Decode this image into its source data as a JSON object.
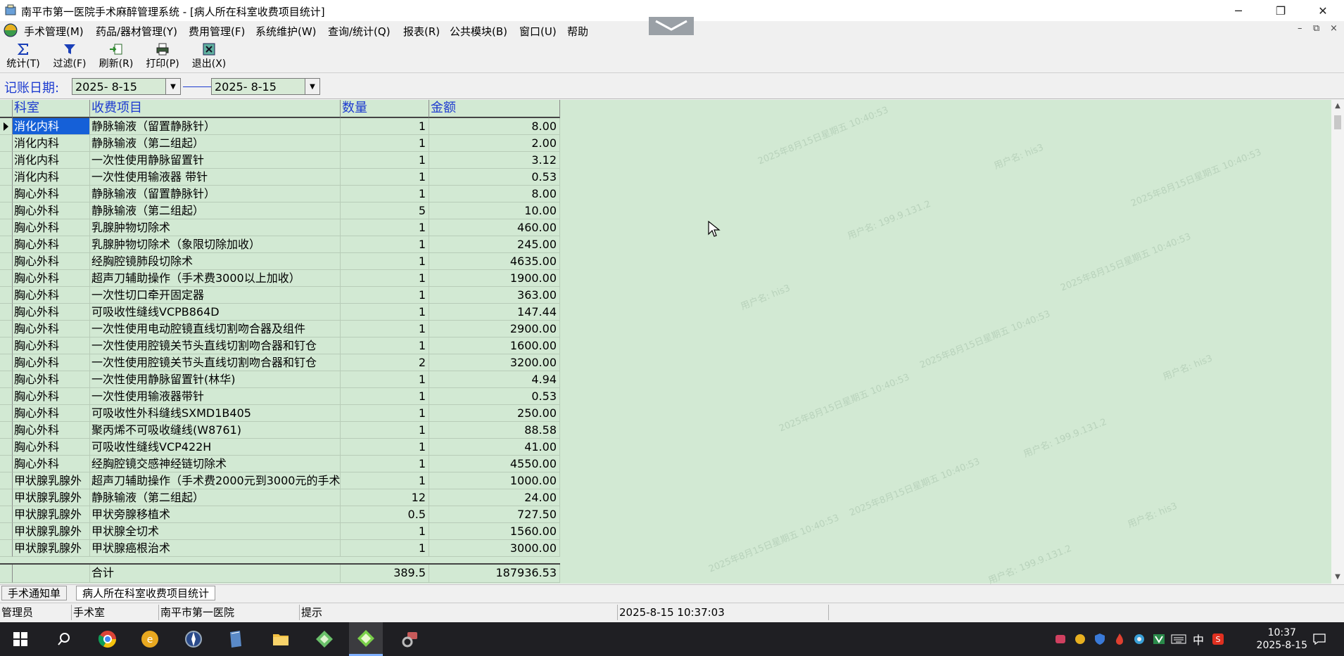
{
  "window": {
    "title": "南平市第一医院手术麻醉管理系统 - [病人所在科室收费项目统计]",
    "minimize": "─",
    "restore": "❐",
    "close": "✕"
  },
  "menu": [
    {
      "label": "手术管理(M)"
    },
    {
      "label": "药品/器材管理(Y)"
    },
    {
      "label": "费用管理(F)"
    },
    {
      "label": "系统维护(W)"
    },
    {
      "label": "查询/统计(Q)"
    },
    {
      "label": "报表(R)"
    },
    {
      "label": "公共模块(B)"
    },
    {
      "label": "窗口(U)"
    },
    {
      "label": "帮助"
    }
  ],
  "mdi_controls": {
    "minimize": "–",
    "restore": "⧉",
    "close": "×"
  },
  "toolbar": [
    {
      "label": "统计(T)",
      "icon": "sigma-icon"
    },
    {
      "label": "过滤(F)",
      "icon": "filter-icon"
    },
    {
      "label": "刷新(R)",
      "icon": "refresh-icon"
    },
    {
      "label": "打印(P)",
      "icon": "print-icon"
    },
    {
      "label": "退出(X)",
      "icon": "exit-icon"
    }
  ],
  "date_filter": {
    "label": "记账日期:",
    "start": "2025- 8-15",
    "end": "2025- 8-15"
  },
  "table": {
    "columns": [
      "科室",
      "收费项目",
      "数量",
      "金额"
    ],
    "rows": [
      {
        "dept": "消化内科",
        "item": "静脉输液（留置静脉针）",
        "qty": "1",
        "amount": "8.00"
      },
      {
        "dept": "消化内科",
        "item": "静脉输液（第二组起）",
        "qty": "1",
        "amount": "2.00"
      },
      {
        "dept": "消化内科",
        "item": "一次性使用静脉留置针",
        "qty": "1",
        "amount": "3.12"
      },
      {
        "dept": "消化内科",
        "item": "一次性使用输液器 带针",
        "qty": "1",
        "amount": "0.53"
      },
      {
        "dept": "胸心外科",
        "item": "静脉输液（留置静脉针）",
        "qty": "1",
        "amount": "8.00"
      },
      {
        "dept": "胸心外科",
        "item": "静脉输液（第二组起）",
        "qty": "5",
        "amount": "10.00"
      },
      {
        "dept": "胸心外科",
        "item": "乳腺肿物切除术",
        "qty": "1",
        "amount": "460.00"
      },
      {
        "dept": "胸心外科",
        "item": "乳腺肿物切除术（象限切除加收）",
        "qty": "1",
        "amount": "245.00"
      },
      {
        "dept": "胸心外科",
        "item": "经胸腔镜肺段切除术",
        "qty": "1",
        "amount": "4635.00"
      },
      {
        "dept": "胸心外科",
        "item": "超声刀辅助操作（手术费3000以上加收）",
        "qty": "1",
        "amount": "1900.00"
      },
      {
        "dept": "胸心外科",
        "item": "一次性切口牵开固定器",
        "qty": "1",
        "amount": "363.00"
      },
      {
        "dept": "胸心外科",
        "item": "可吸收性缝线VCPB864D",
        "qty": "1",
        "amount": "147.44"
      },
      {
        "dept": "胸心外科",
        "item": "一次性使用电动腔镜直线切割吻合器及组件",
        "qty": "1",
        "amount": "2900.00"
      },
      {
        "dept": "胸心外科",
        "item": "一次性使用腔镜关节头直线切割吻合器和钉仓",
        "qty": "1",
        "amount": "1600.00"
      },
      {
        "dept": "胸心外科",
        "item": "一次性使用腔镜关节头直线切割吻合器和钉仓",
        "qty": "2",
        "amount": "3200.00"
      },
      {
        "dept": "胸心外科",
        "item": "一次性使用静脉留置针(林华)",
        "qty": "1",
        "amount": "4.94"
      },
      {
        "dept": "胸心外科",
        "item": "一次性使用输液器带针",
        "qty": "1",
        "amount": "0.53"
      },
      {
        "dept": "胸心外科",
        "item": "可吸收性外科缝线SXMD1B405",
        "qty": "1",
        "amount": "250.00"
      },
      {
        "dept": "胸心外科",
        "item": "聚丙烯不可吸收缝线(W8761)",
        "qty": "1",
        "amount": "88.58"
      },
      {
        "dept": "胸心外科",
        "item": "可吸收性缝线VCP422H",
        "qty": "1",
        "amount": "41.00"
      },
      {
        "dept": "胸心外科",
        "item": "经胸腔镜交感神经链切除术",
        "qty": "1",
        "amount": "4550.00"
      },
      {
        "dept": "甲状腺乳腺外",
        "item": "超声刀辅助操作（手术费2000元到3000元的手术",
        "qty": "1",
        "amount": "1000.00"
      },
      {
        "dept": "甲状腺乳腺外",
        "item": "静脉输液（第二组起）",
        "qty": "12",
        "amount": "24.00"
      },
      {
        "dept": "甲状腺乳腺外",
        "item": "甲状旁腺移植术",
        "qty": "0.5",
        "amount": "727.50"
      },
      {
        "dept": "甲状腺乳腺外",
        "item": "甲状腺全切术",
        "qty": "1",
        "amount": "1560.00"
      },
      {
        "dept": "甲状腺乳腺外",
        "item": "甲状腺癌根治术",
        "qty": "1",
        "amount": "3000.00"
      }
    ],
    "total": {
      "label": "合计",
      "qty": "389.5",
      "amount": "187936.53"
    }
  },
  "tabs": [
    {
      "label": "手术通知单"
    },
    {
      "label": "病人所在科室收费项目统计"
    }
  ],
  "status": {
    "user": "管理员",
    "dept": "手术室",
    "hospital": "南平市第一医院",
    "hint": "提示",
    "datetime": "2025-8-15 10:37:03"
  },
  "taskbar": {
    "ime": "中",
    "time": "10:37",
    "date": "2025-8-15"
  },
  "colors": {
    "grid_bg": "#d2e9d3",
    "header_text": "#1d3bd0",
    "selection": "#1560d8"
  }
}
